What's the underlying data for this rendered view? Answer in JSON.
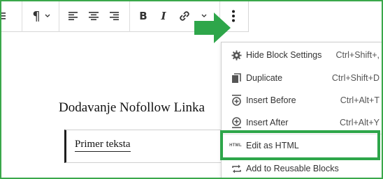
{
  "colors": {
    "accent_green": "#2ea64a",
    "frame_green": "#3aa84a"
  },
  "toolbar": {
    "paragraph_icon": "pilcrow-icon",
    "buttons": [
      {
        "name": "align-left-icon"
      },
      {
        "name": "align-center-icon"
      },
      {
        "name": "align-right-icon"
      },
      {
        "name": "bold-icon",
        "label": "B"
      },
      {
        "name": "italic-icon",
        "label": "I"
      },
      {
        "name": "link-icon"
      },
      {
        "name": "more-options-icon"
      }
    ]
  },
  "editor": {
    "heading": "Dodavanje Nofollow Linka",
    "quote": "Primer teksta"
  },
  "menu": {
    "items": [
      {
        "icon": "gear-icon",
        "label": "Hide Block Settings",
        "shortcut": "Ctrl+Shift+,"
      },
      {
        "icon": "duplicate-icon",
        "label": "Duplicate",
        "shortcut": "Ctrl+Shift+D"
      },
      {
        "icon": "insert-before-icon",
        "label": "Insert Before",
        "shortcut": "Ctrl+Alt+T"
      },
      {
        "icon": "insert-after-icon",
        "label": "Insert After",
        "shortcut": "Ctrl+Alt+Y"
      },
      {
        "icon": "html-icon",
        "label": "Edit as HTML",
        "icon_text": "HTML"
      },
      {
        "icon": "reusable-block-icon",
        "label": "Add to Reusable Blocks"
      }
    ]
  }
}
